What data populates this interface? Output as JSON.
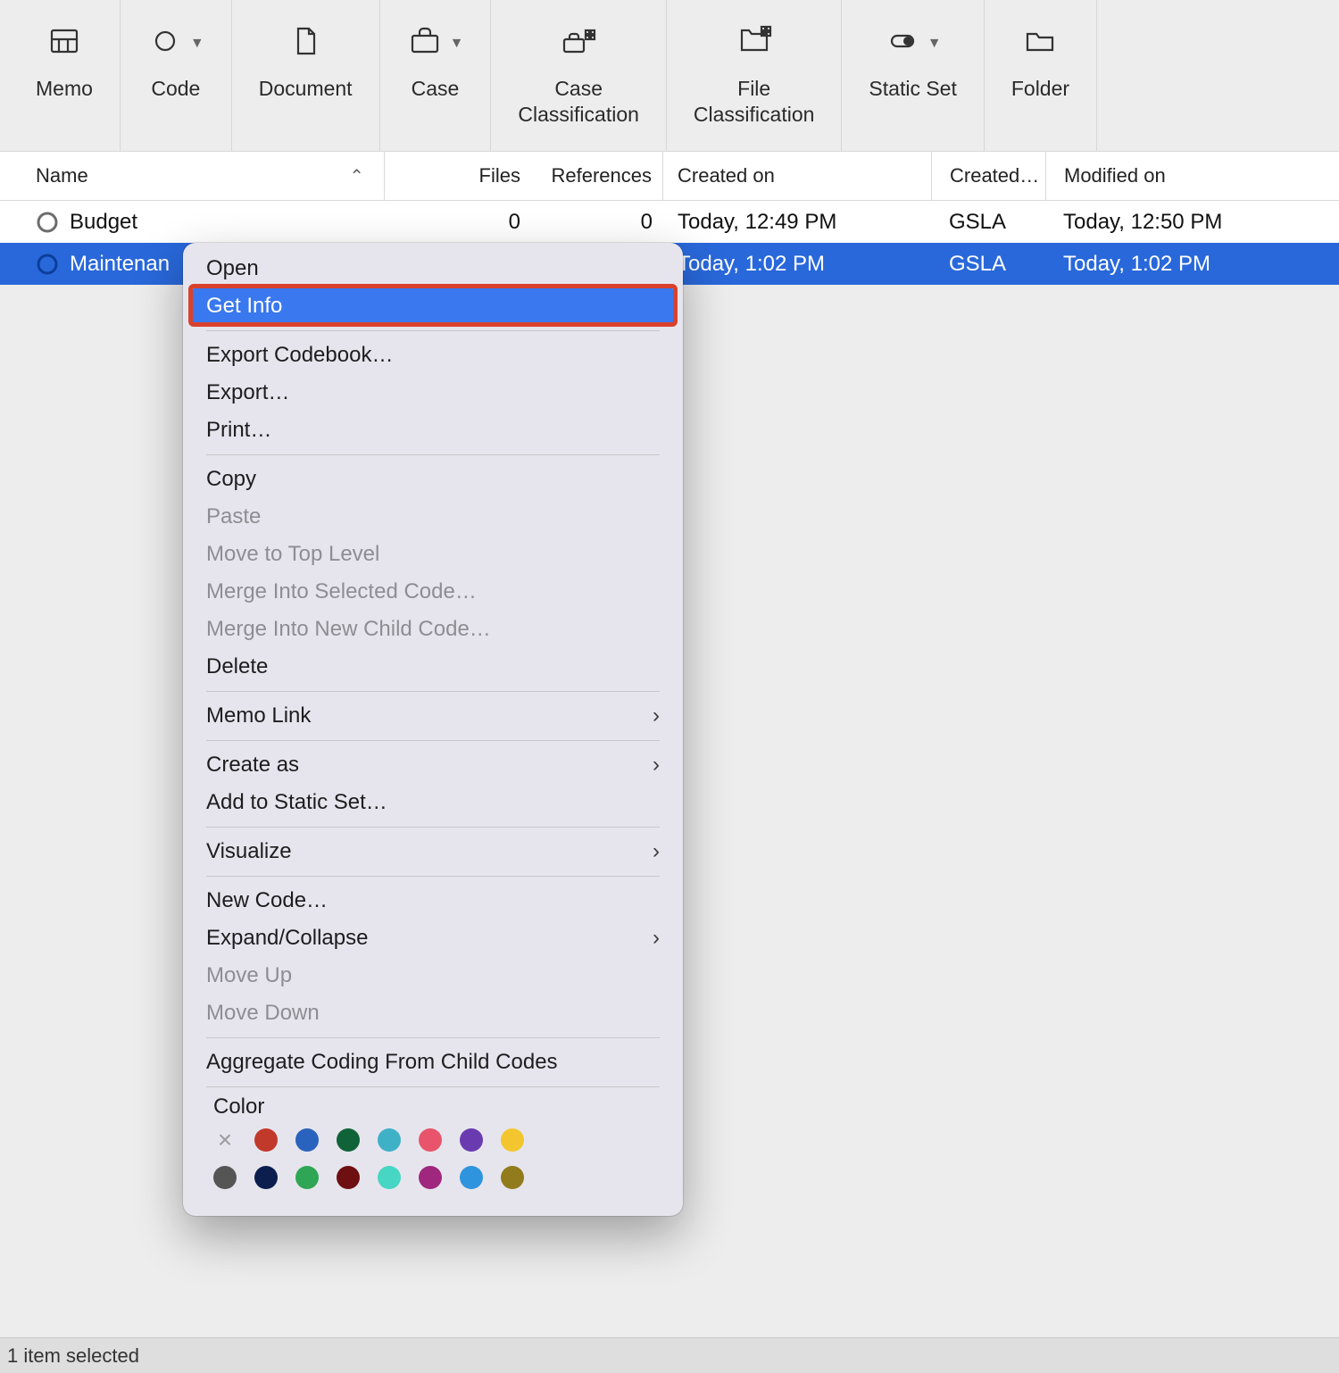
{
  "toolbar": [
    {
      "label": "Memo",
      "icon": "memo",
      "dropdown": false
    },
    {
      "label": "Code",
      "icon": "code",
      "dropdown": true
    },
    {
      "label": "Document",
      "icon": "document",
      "dropdown": false
    },
    {
      "label": "Case",
      "icon": "case",
      "dropdown": true
    },
    {
      "label": "Case\nClassification",
      "icon": "case-class",
      "dropdown": false
    },
    {
      "label": "File\nClassification",
      "icon": "file-class",
      "dropdown": false
    },
    {
      "label": "Static Set",
      "icon": "static-set",
      "dropdown": true
    },
    {
      "label": "Folder",
      "icon": "folder",
      "dropdown": false
    }
  ],
  "columns": {
    "name": "Name",
    "files": "Files",
    "references": "References",
    "created_on": "Created on",
    "created_by": "Created…",
    "modified_on": "Modified on"
  },
  "rows": [
    {
      "name": "Budget",
      "files": 0,
      "references": 0,
      "created_on": "Today, 12:49 PM",
      "created_by": "GSLA",
      "modified_on": "Today, 12:50 PM",
      "selected": false
    },
    {
      "name": "Maintenan",
      "files": "",
      "references": "",
      "created_on": "Today, 1:02 PM",
      "created_by": "GSLA",
      "modified_on": "Today, 1:02 PM",
      "selected": true
    }
  ],
  "context_menu": {
    "items": [
      {
        "label": "Open",
        "type": "item"
      },
      {
        "label": "Get Info",
        "type": "item",
        "highlighted": true
      },
      {
        "type": "sep"
      },
      {
        "label": "Export Codebook…",
        "type": "item"
      },
      {
        "label": "Export…",
        "type": "item"
      },
      {
        "label": "Print…",
        "type": "item"
      },
      {
        "type": "sep"
      },
      {
        "label": "Copy",
        "type": "item"
      },
      {
        "label": "Paste",
        "type": "item",
        "disabled": true
      },
      {
        "label": "Move to Top Level",
        "type": "item",
        "disabled": true
      },
      {
        "label": "Merge Into Selected Code…",
        "type": "item",
        "disabled": true
      },
      {
        "label": "Merge Into New Child Code…",
        "type": "item",
        "disabled": true
      },
      {
        "label": "Delete",
        "type": "item"
      },
      {
        "type": "sep"
      },
      {
        "label": "Memo Link",
        "type": "submenu"
      },
      {
        "type": "sep"
      },
      {
        "label": "Create as",
        "type": "submenu"
      },
      {
        "label": "Add to Static Set…",
        "type": "item"
      },
      {
        "type": "sep"
      },
      {
        "label": "Visualize",
        "type": "submenu"
      },
      {
        "type": "sep"
      },
      {
        "label": "New Code…",
        "type": "item"
      },
      {
        "label": "Expand/Collapse",
        "type": "submenu"
      },
      {
        "label": "Move Up",
        "type": "item",
        "disabled": true
      },
      {
        "label": "Move Down",
        "type": "item",
        "disabled": true
      },
      {
        "type": "sep"
      },
      {
        "label": "Aggregate Coding From Child Codes",
        "type": "item"
      },
      {
        "type": "sep"
      }
    ],
    "color_label": "Color",
    "colors_row1": [
      "none",
      "#c1392b",
      "#2a63bd",
      "#106338",
      "#3fb1c7",
      "#e8546b",
      "#6a3bb0",
      "#f3c62f"
    ],
    "colors_row2": [
      "#555555",
      "#0b1e4d",
      "#2fa653",
      "#6e0f12",
      "#47d6c3",
      "#a0277e",
      "#2f94de",
      "#927b1c"
    ]
  },
  "status_bar": "1 item selected"
}
